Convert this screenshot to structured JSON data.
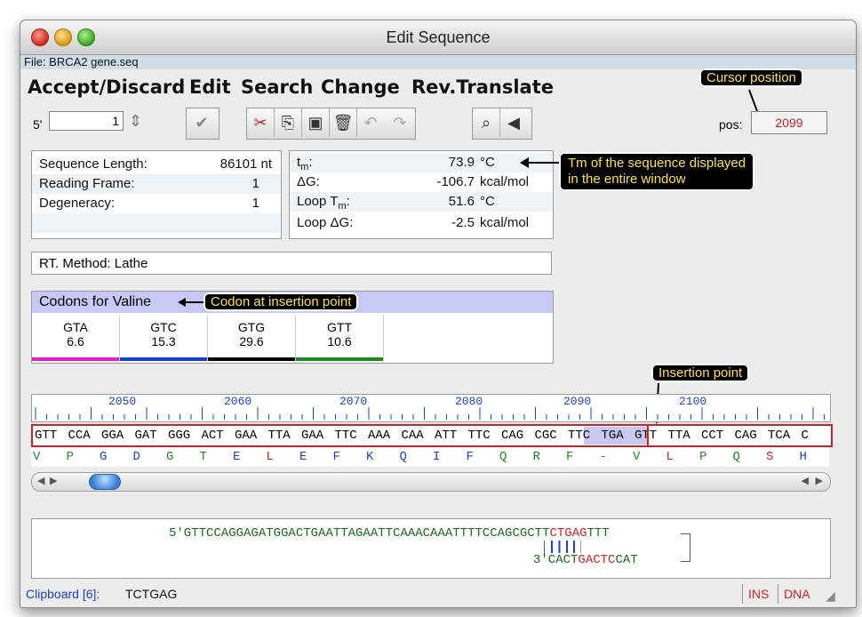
{
  "window": {
    "title": "Edit Sequence",
    "file_label": "File: BRCA2 gene.seq"
  },
  "menu": [
    "Accept/Discard",
    "Edit",
    "Search",
    "Change",
    "Rev.Translate"
  ],
  "callouts": {
    "cursor": "Cursor position",
    "tm": "Tm of the sequence displayed",
    "tm_line2": "in the entire window",
    "codon": "Codon at insertion point",
    "insertion": "Insertion point"
  },
  "toolbar": {
    "strand": "5'",
    "position_value": "1",
    "pos_label": "pos:",
    "pos_value": "2099"
  },
  "seq_info": [
    {
      "label": "Sequence Length:",
      "value": "86101 nt"
    },
    {
      "label": "Reading Frame:",
      "value": "1"
    },
    {
      "label": "Degeneracy:",
      "value": "1"
    }
  ],
  "thermo": [
    {
      "label_main": "t",
      "label_sub": "m",
      "label_tail": ":",
      "value": "73.9",
      "unit": "°C"
    },
    {
      "label_main": "ΔG:",
      "label_sub": "",
      "label_tail": "",
      "value": "-106.7",
      "unit": "kcal/mol"
    },
    {
      "label_main": "Loop T",
      "label_sub": "m",
      "label_tail": ":",
      "value": "51.6",
      "unit": "°C"
    },
    {
      "label_main": "Loop ΔG:",
      "label_sub": "",
      "label_tail": "",
      "value": "-2.5",
      "unit": "kcal/mol"
    }
  ],
  "rt_method": "RT. Method: Lathe",
  "codons": {
    "title": "Codons for Valine",
    "items": [
      {
        "codon": "GTA",
        "value": "6.6",
        "color": "#e020c0"
      },
      {
        "codon": "GTC",
        "value": "15.3",
        "color": "#1a3fd0"
      },
      {
        "codon": "GTG",
        "value": "29.6",
        "color": "#000000"
      },
      {
        "codon": "GTT",
        "value": "10.6",
        "color": "#1d8a1d"
      }
    ]
  },
  "ruler_labels": [
    "2050",
    "2060",
    "2070",
    "2080",
    "2090",
    "2100"
  ],
  "dna_codons": [
    "GTT",
    "CCA",
    "GGA",
    "GAT",
    "GGG",
    "ACT",
    "GAA",
    "TTA",
    "GAA",
    "TTC",
    "AAA",
    "CAA",
    "ATT",
    "TTC",
    "CAG",
    "CGC",
    "TTC",
    "TGA",
    "GTT",
    "TTA",
    "CCT",
    "CAG",
    "TCA",
    "C"
  ],
  "amino_acids": [
    {
      "aa": "V",
      "color": "#1d8a1d"
    },
    {
      "aa": "P",
      "color": "#1d8a1d"
    },
    {
      "aa": "G",
      "color": "#1a3fd0"
    },
    {
      "aa": "D",
      "color": "#1a3fd0"
    },
    {
      "aa": "G",
      "color": "#1d8a1d"
    },
    {
      "aa": "T",
      "color": "#1d8a1d"
    },
    {
      "aa": "E",
      "color": "#1a3fd0"
    },
    {
      "aa": "L",
      "color": "#d02020"
    },
    {
      "aa": "E",
      "color": "#1a3fd0"
    },
    {
      "aa": "F",
      "color": "#1a3fd0"
    },
    {
      "aa": "K",
      "color": "#1a3fd0"
    },
    {
      "aa": "Q",
      "color": "#1a3fd0"
    },
    {
      "aa": "I",
      "color": "#1a3fd0"
    },
    {
      "aa": "F",
      "color": "#1a3fd0"
    },
    {
      "aa": "Q",
      "color": "#1d8a1d"
    },
    {
      "aa": "R",
      "color": "#1d8a1d"
    },
    {
      "aa": "F",
      "color": "#1d8a1d"
    },
    {
      "aa": "-",
      "color": "#1d8a1d"
    },
    {
      "aa": "V",
      "color": "#1d8a1d"
    },
    {
      "aa": "L",
      "color": "#d02020"
    },
    {
      "aa": "P",
      "color": "#1d8a1d"
    },
    {
      "aa": "Q",
      "color": "#1d8a1d"
    },
    {
      "aa": "S",
      "color": "#d02020"
    },
    {
      "aa": "H",
      "color": "#1a3fd0"
    }
  ],
  "oligo": {
    "top_prefix": "5'GTTCCAGGAGATGGACTGAATTAGAATTCAAACAAATTTTCCAGCGCTT",
    "top_red": "CTGAG",
    "top_suffix": "TTT",
    "bottom_prefix": "3'CACT",
    "bottom_red": "GACTC",
    "bottom_suffix": "CAT"
  },
  "status": {
    "clipboard_label": "Clipboard [6]:",
    "clipboard_value": "TCTGAG",
    "ins": "INS",
    "dna": "DNA"
  },
  "colors": {
    "red": "#d02020",
    "blue": "#1a3fd0",
    "green": "#1d8a1d",
    "callout_text": "#ffe14a",
    "codon_header": "#c8c8f4",
    "highlight": "#c8c8f0"
  }
}
